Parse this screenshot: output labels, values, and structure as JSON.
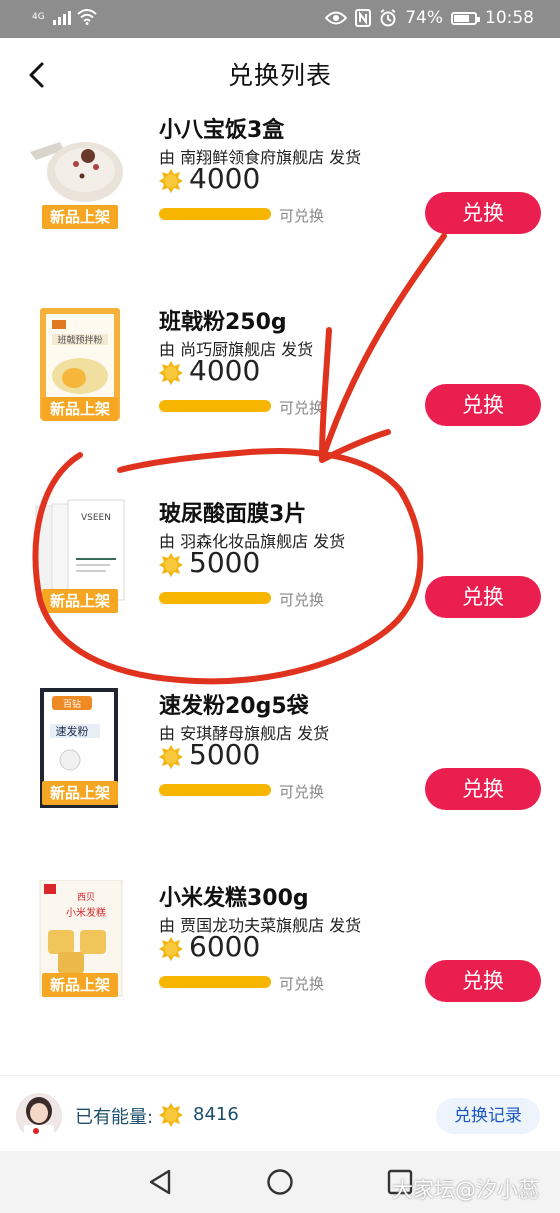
{
  "status_bar": {
    "network": "4G",
    "battery": "74%",
    "battery_level": 0.74,
    "time": "10:58"
  },
  "header": {
    "title": "兑换列表"
  },
  "items": [
    {
      "name": "小八宝饭3盒",
      "seller": "由 南翔鲜领食府旗舰店 发货",
      "price": "4000",
      "badge": "新品上架",
      "status": "可兑换",
      "button": "兑换"
    },
    {
      "name": "班戟粉250g",
      "seller": "由 尚巧厨旗舰店 发货",
      "price": "4000",
      "badge": "新品上架",
      "status": "可兑换",
      "button": "兑换"
    },
    {
      "name": "玻尿酸面膜3片",
      "seller": "由 羽森化妆品旗舰店 发货",
      "price": "5000",
      "badge": "新品上架",
      "status": "可兑换",
      "button": "兑换"
    },
    {
      "name": "速发粉20g5袋",
      "seller": "由 安琪酵母旗舰店 发货",
      "price": "5000",
      "badge": "新品上架",
      "status": "可兑换",
      "button": "兑换"
    },
    {
      "name": "小米发糕300g",
      "seller": "由 贾国龙功夫菜旗舰店 发货",
      "price": "6000",
      "badge": "新品上架",
      "status": "可兑换",
      "button": "兑换"
    }
  ],
  "product_labels": {
    "item2_pack": "班戟预拌粉",
    "item3_pack": "VSEEN",
    "item4_brand": "百钻",
    "item4_pack": "速发粉",
    "item5_brand": "西贝",
    "item5_pack": "小米发糕"
  },
  "energy": {
    "label": "已有能量:",
    "value": "8416",
    "records_button": "兑换记录"
  },
  "watermark": "大家坛@汐小蕊",
  "colors": {
    "accent": "#ea1f4f",
    "badge": "#f5a623",
    "bar": "#f7b500",
    "annotation": "#e0331f"
  }
}
